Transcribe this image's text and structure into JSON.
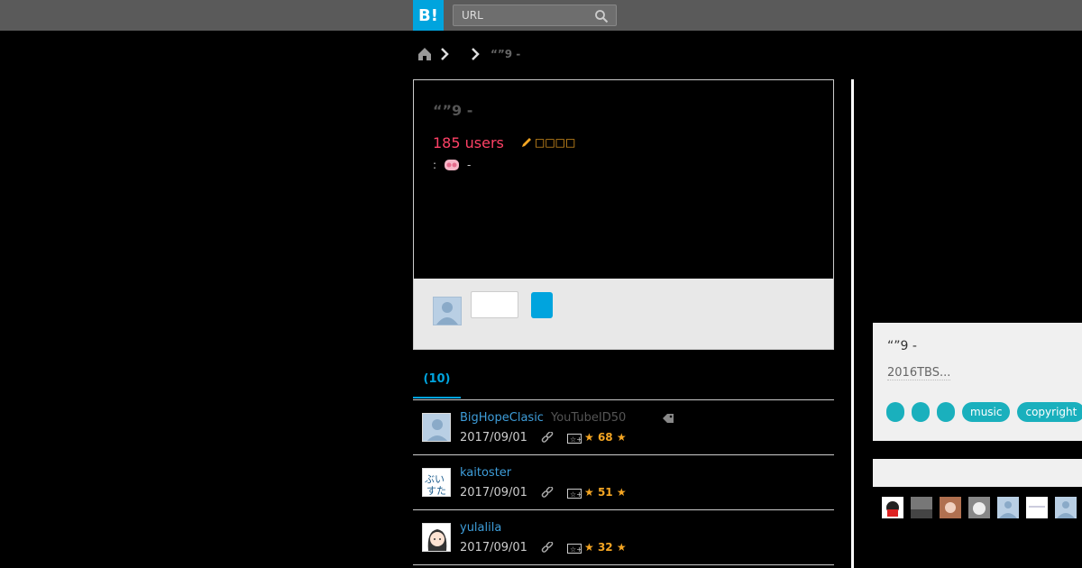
{
  "header": {
    "logo": "B!",
    "search_placeholder": "URL"
  },
  "breadcrumb": {
    "current": "“”9 -"
  },
  "entry": {
    "title": "“”9 -",
    "users": "185 users",
    "edit_label": "□□□□",
    "meta_prefix": ":",
    "meta_suffix": "-"
  },
  "tabs": [
    {
      "label": "(10)"
    }
  ],
  "bookmarks": [
    {
      "name": "BigHopeClasic",
      "comment": "YouTubeID50",
      "date": "2017/09/01",
      "stars": "68"
    },
    {
      "name": "kaitoster",
      "comment": "",
      "date": "2017/09/01",
      "stars": "51"
    },
    {
      "name": "yulalila",
      "comment": "",
      "date": "2017/09/01",
      "stars": "32"
    }
  ],
  "sidebar_card": {
    "title": "“”9 -",
    "description": "2016TBS...",
    "tags": [
      "music",
      "copyright"
    ]
  },
  "colors": {
    "accent": "#00a4de",
    "users": "#ff4166",
    "tag": "#1ab0bd",
    "star": "#f5a623"
  }
}
